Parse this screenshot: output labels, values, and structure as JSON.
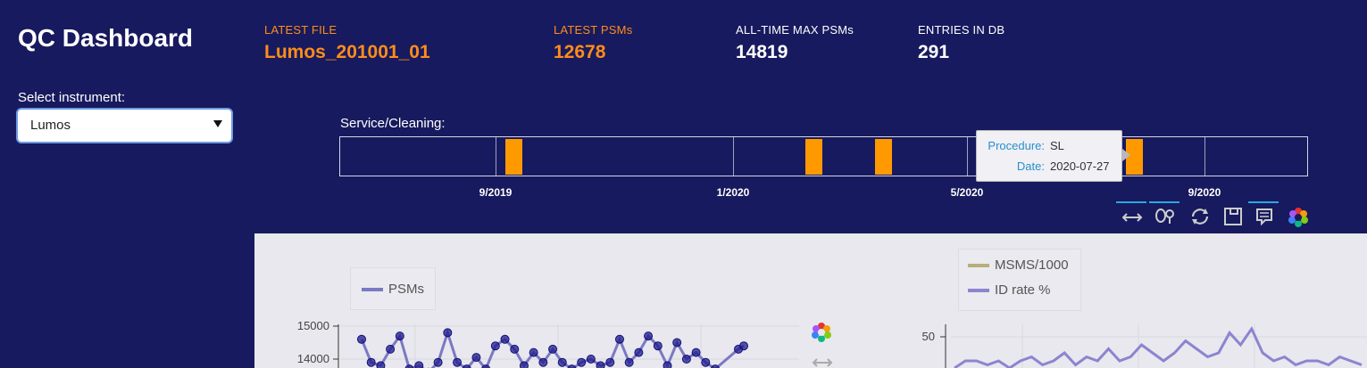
{
  "app": {
    "title": "QC Dashboard",
    "select_label": "Select instrument:",
    "selected_instrument": "Lumos"
  },
  "stats": [
    {
      "label": "LATEST FILE",
      "value": "Lumos_201001_01",
      "color": "#ff8c1a"
    },
    {
      "label": "LATEST PSMs",
      "value": "12678",
      "color": "#ff8c1a"
    },
    {
      "label": "ALL-TIME MAX PSMs",
      "value": "14819",
      "color": "#ffffff"
    },
    {
      "label": "ENTRIES IN DB",
      "value": "291",
      "color": "#ffffff"
    }
  ],
  "service": {
    "label": "Service/Cleaning:",
    "ticks": [
      "9/2019",
      "1/2020",
      "5/2020",
      "9/2020"
    ],
    "event_count": 4,
    "tooltip": {
      "k1": "Procedure:",
      "v1": "SL",
      "k2": "Date:",
      "v2": "2020-07-27"
    }
  },
  "toolbar": {
    "icons": [
      "pan-icon",
      "wheel-zoom-icon",
      "reset-icon",
      "save-icon",
      "hover-icon",
      "bokeh-logo-icon"
    ]
  },
  "colors": {
    "background": "#171a5e",
    "accent_orange": "#ff8c1a",
    "service_bar": "#ff9900",
    "psm_line": "#7b78c4",
    "psm_point": "#1f1b8c",
    "msms_line": "#b9ad78",
    "idrate_line": "#8c84d0"
  },
  "chart_data": [
    {
      "type": "line",
      "series": [
        {
          "name": "PSMs",
          "values": [
            14600,
            13900,
            13800,
            14300,
            14700,
            13700,
            13800,
            13600,
            13900,
            14800,
            13900,
            13700,
            14050,
            13700,
            14400,
            14600,
            14300,
            13800,
            14200,
            13900,
            14300,
            13900,
            13700,
            13900,
            14000,
            13800,
            13900,
            14600,
            13900,
            14200,
            14700,
            14400,
            13800,
            14500,
            14000,
            14200,
            13900,
            13700,
            14300,
            14400
          ]
        }
      ],
      "ylim": [
        13600,
        15100
      ],
      "yticks": [
        "15000",
        "14000"
      ],
      "legend": "top-left"
    },
    {
      "type": "line",
      "series": [
        {
          "name": "MSMS/1000",
          "values": []
        },
        {
          "name": "ID rate %",
          "values": [
            42,
            44,
            44,
            43,
            44,
            41,
            44,
            45,
            43,
            44,
            46,
            43,
            45,
            44,
            47,
            44,
            45,
            48,
            46,
            44,
            46,
            49,
            47,
            45,
            46,
            51,
            48,
            52,
            46,
            44,
            45,
            43,
            44,
            44,
            43,
            45,
            44,
            43
          ]
        }
      ],
      "yticks": [
        "50"
      ],
      "legend": "top-left"
    }
  ]
}
